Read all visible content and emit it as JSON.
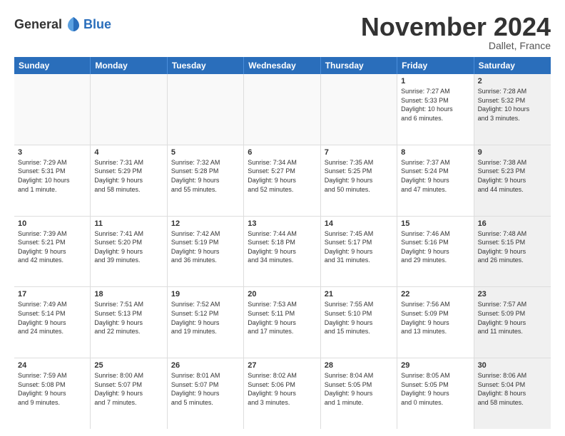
{
  "logo": {
    "general": "General",
    "blue": "Blue"
  },
  "title": "November 2024",
  "location": "Dallet, France",
  "days_of_week": [
    "Sunday",
    "Monday",
    "Tuesday",
    "Wednesday",
    "Thursday",
    "Friday",
    "Saturday"
  ],
  "weeks": [
    [
      {
        "day": "",
        "info": "",
        "empty": true
      },
      {
        "day": "",
        "info": "",
        "empty": true
      },
      {
        "day": "",
        "info": "",
        "empty": true
      },
      {
        "day": "",
        "info": "",
        "empty": true
      },
      {
        "day": "",
        "info": "",
        "empty": true
      },
      {
        "day": "1",
        "info": "Sunrise: 7:27 AM\nSunset: 5:33 PM\nDaylight: 10 hours\nand 6 minutes.",
        "empty": false,
        "shaded": false
      },
      {
        "day": "2",
        "info": "Sunrise: 7:28 AM\nSunset: 5:32 PM\nDaylight: 10 hours\nand 3 minutes.",
        "empty": false,
        "shaded": true
      }
    ],
    [
      {
        "day": "3",
        "info": "Sunrise: 7:29 AM\nSunset: 5:31 PM\nDaylight: 10 hours\nand 1 minute.",
        "empty": false,
        "shaded": false
      },
      {
        "day": "4",
        "info": "Sunrise: 7:31 AM\nSunset: 5:29 PM\nDaylight: 9 hours\nand 58 minutes.",
        "empty": false,
        "shaded": false
      },
      {
        "day": "5",
        "info": "Sunrise: 7:32 AM\nSunset: 5:28 PM\nDaylight: 9 hours\nand 55 minutes.",
        "empty": false,
        "shaded": false
      },
      {
        "day": "6",
        "info": "Sunrise: 7:34 AM\nSunset: 5:27 PM\nDaylight: 9 hours\nand 52 minutes.",
        "empty": false,
        "shaded": false
      },
      {
        "day": "7",
        "info": "Sunrise: 7:35 AM\nSunset: 5:25 PM\nDaylight: 9 hours\nand 50 minutes.",
        "empty": false,
        "shaded": false
      },
      {
        "day": "8",
        "info": "Sunrise: 7:37 AM\nSunset: 5:24 PM\nDaylight: 9 hours\nand 47 minutes.",
        "empty": false,
        "shaded": false
      },
      {
        "day": "9",
        "info": "Sunrise: 7:38 AM\nSunset: 5:23 PM\nDaylight: 9 hours\nand 44 minutes.",
        "empty": false,
        "shaded": true
      }
    ],
    [
      {
        "day": "10",
        "info": "Sunrise: 7:39 AM\nSunset: 5:21 PM\nDaylight: 9 hours\nand 42 minutes.",
        "empty": false,
        "shaded": false
      },
      {
        "day": "11",
        "info": "Sunrise: 7:41 AM\nSunset: 5:20 PM\nDaylight: 9 hours\nand 39 minutes.",
        "empty": false,
        "shaded": false
      },
      {
        "day": "12",
        "info": "Sunrise: 7:42 AM\nSunset: 5:19 PM\nDaylight: 9 hours\nand 36 minutes.",
        "empty": false,
        "shaded": false
      },
      {
        "day": "13",
        "info": "Sunrise: 7:44 AM\nSunset: 5:18 PM\nDaylight: 9 hours\nand 34 minutes.",
        "empty": false,
        "shaded": false
      },
      {
        "day": "14",
        "info": "Sunrise: 7:45 AM\nSunset: 5:17 PM\nDaylight: 9 hours\nand 31 minutes.",
        "empty": false,
        "shaded": false
      },
      {
        "day": "15",
        "info": "Sunrise: 7:46 AM\nSunset: 5:16 PM\nDaylight: 9 hours\nand 29 minutes.",
        "empty": false,
        "shaded": false
      },
      {
        "day": "16",
        "info": "Sunrise: 7:48 AM\nSunset: 5:15 PM\nDaylight: 9 hours\nand 26 minutes.",
        "empty": false,
        "shaded": true
      }
    ],
    [
      {
        "day": "17",
        "info": "Sunrise: 7:49 AM\nSunset: 5:14 PM\nDaylight: 9 hours\nand 24 minutes.",
        "empty": false,
        "shaded": false
      },
      {
        "day": "18",
        "info": "Sunrise: 7:51 AM\nSunset: 5:13 PM\nDaylight: 9 hours\nand 22 minutes.",
        "empty": false,
        "shaded": false
      },
      {
        "day": "19",
        "info": "Sunrise: 7:52 AM\nSunset: 5:12 PM\nDaylight: 9 hours\nand 19 minutes.",
        "empty": false,
        "shaded": false
      },
      {
        "day": "20",
        "info": "Sunrise: 7:53 AM\nSunset: 5:11 PM\nDaylight: 9 hours\nand 17 minutes.",
        "empty": false,
        "shaded": false
      },
      {
        "day": "21",
        "info": "Sunrise: 7:55 AM\nSunset: 5:10 PM\nDaylight: 9 hours\nand 15 minutes.",
        "empty": false,
        "shaded": false
      },
      {
        "day": "22",
        "info": "Sunrise: 7:56 AM\nSunset: 5:09 PM\nDaylight: 9 hours\nand 13 minutes.",
        "empty": false,
        "shaded": false
      },
      {
        "day": "23",
        "info": "Sunrise: 7:57 AM\nSunset: 5:09 PM\nDaylight: 9 hours\nand 11 minutes.",
        "empty": false,
        "shaded": true
      }
    ],
    [
      {
        "day": "24",
        "info": "Sunrise: 7:59 AM\nSunset: 5:08 PM\nDaylight: 9 hours\nand 9 minutes.",
        "empty": false,
        "shaded": false
      },
      {
        "day": "25",
        "info": "Sunrise: 8:00 AM\nSunset: 5:07 PM\nDaylight: 9 hours\nand 7 minutes.",
        "empty": false,
        "shaded": false
      },
      {
        "day": "26",
        "info": "Sunrise: 8:01 AM\nSunset: 5:07 PM\nDaylight: 9 hours\nand 5 minutes.",
        "empty": false,
        "shaded": false
      },
      {
        "day": "27",
        "info": "Sunrise: 8:02 AM\nSunset: 5:06 PM\nDaylight: 9 hours\nand 3 minutes.",
        "empty": false,
        "shaded": false
      },
      {
        "day": "28",
        "info": "Sunrise: 8:04 AM\nSunset: 5:05 PM\nDaylight: 9 hours\nand 1 minute.",
        "empty": false,
        "shaded": false
      },
      {
        "day": "29",
        "info": "Sunrise: 8:05 AM\nSunset: 5:05 PM\nDaylight: 9 hours\nand 0 minutes.",
        "empty": false,
        "shaded": false
      },
      {
        "day": "30",
        "info": "Sunrise: 8:06 AM\nSunset: 5:04 PM\nDaylight: 8 hours\nand 58 minutes.",
        "empty": false,
        "shaded": true
      }
    ]
  ]
}
